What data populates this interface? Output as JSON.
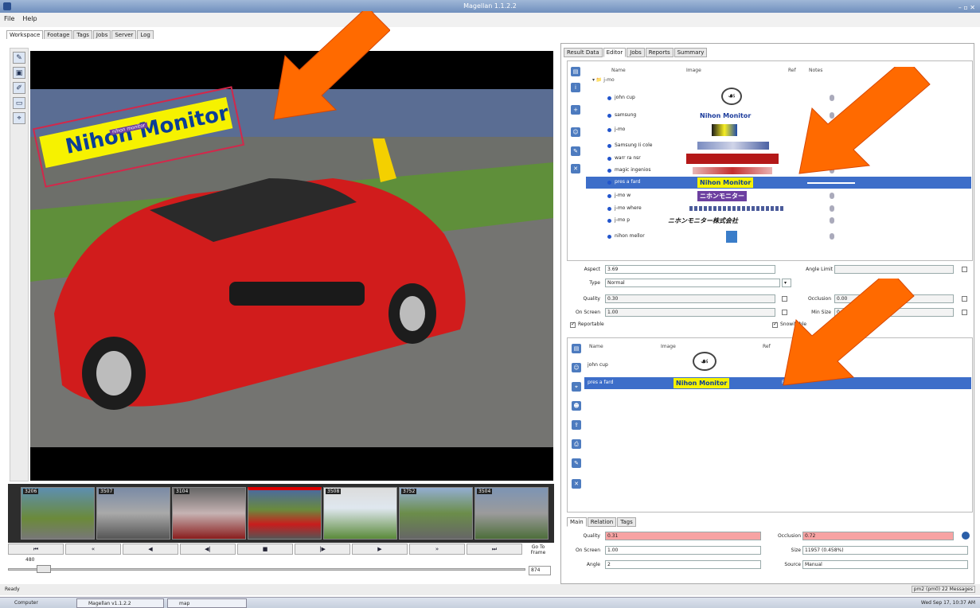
{
  "window": {
    "title": "Magellan 1.1.2.2"
  },
  "menu": [
    "File",
    "Help"
  ],
  "main_tabs": [
    "Workspace",
    "Footage",
    "Tags",
    "Jobs",
    "Server",
    "Log"
  ],
  "viewer": {
    "overlay_logo_text": "Nihon Monitor",
    "overlay_tag": "nihon monitor"
  },
  "filmstrip": {
    "frames": [
      "3206",
      "3507",
      "3104",
      "",
      "3508",
      "3752",
      "3504"
    ]
  },
  "transport": {
    "buttons": [
      "⏮",
      "«",
      "◀",
      "◀|",
      "■",
      "|▶",
      "▶",
      "»",
      "⏭"
    ],
    "go_to": "Go To Frame",
    "slider_value": "480",
    "frame_value": "874"
  },
  "right_tabs": [
    "Result Data",
    "Editor",
    "Jobs",
    "Reports",
    "Summary"
  ],
  "tags_table": {
    "headers": [
      "Name",
      "Image",
      "Ref",
      "Notes"
    ],
    "root": "j-mo",
    "rows": [
      {
        "name": "john cup",
        "logo": "",
        "selected": false
      },
      {
        "name": "samsung",
        "logo": "Nihon Monitor",
        "selected": false
      },
      {
        "name": "j-mo",
        "logo": "",
        "selected": false
      },
      {
        "name": "Samsung Ii cole",
        "logo": "",
        "selected": false
      },
      {
        "name": "warr ra nsr",
        "logo": "",
        "selected": false
      },
      {
        "name": "magic ingenios",
        "logo": "",
        "selected": false
      },
      {
        "name": "pres a fard",
        "logo": "Nihon Monitor",
        "selected": true
      },
      {
        "name": "j-mo w",
        "logo": "ニホンモニター",
        "selected": false
      },
      {
        "name": "j-mo where",
        "logo": "",
        "selected": false
      },
      {
        "name": "j-mo p",
        "logo": "ニホンモニター株式会社",
        "selected": false
      },
      {
        "name": "nihon mellor",
        "logo": "",
        "selected": false
      }
    ]
  },
  "props": {
    "aspect_label": "Aspect",
    "aspect_value": "3.69",
    "angle_limit_label": "Angle Limit",
    "type_label": "Type",
    "type_value": "Normal",
    "quality_label": "Quality",
    "quality_value": "0.30",
    "occlusion_label": "Occlusion",
    "occlusion_value": "0.00",
    "onscreen_label": "On Screen",
    "onscreen_value": "1.00",
    "minsize_label": "Min Size",
    "minsize_value": "0.00",
    "reportable": "Reportable",
    "snowitable": "Snowitable"
  },
  "tracks_table": {
    "headers": [
      "Name",
      "Image",
      "Ref"
    ],
    "rows": [
      {
        "name": "john cup",
        "logo": "",
        "ref": "",
        "selected": false
      },
      {
        "name": "pres a fard",
        "logo": "Nihon Monitor",
        "ref": "Free",
        "selected": true
      }
    ]
  },
  "bottom_tabs": [
    "Main",
    "Relation",
    "Tags"
  ],
  "track_props": {
    "quality_label": "Quality",
    "quality_value": "0.31",
    "occlusion_label": "Occlusion",
    "occlusion_value": "0.72",
    "onscreen_label": "On Screen",
    "onscreen_value": "1.00",
    "size_label": "Size",
    "size_value": "11957 (0.458%)",
    "angle_label": "Angle",
    "angle_value": "2",
    "source_label": "Source",
    "source_value": "Manual"
  },
  "status": {
    "left": "Ready",
    "right": "pm2 (pm0) 22 Messages"
  },
  "taskbar": {
    "items": [
      "Computer",
      "Magellan v1.1.2.2",
      "map"
    ],
    "clock": "Wed Sep 17, 10:37 AM"
  }
}
